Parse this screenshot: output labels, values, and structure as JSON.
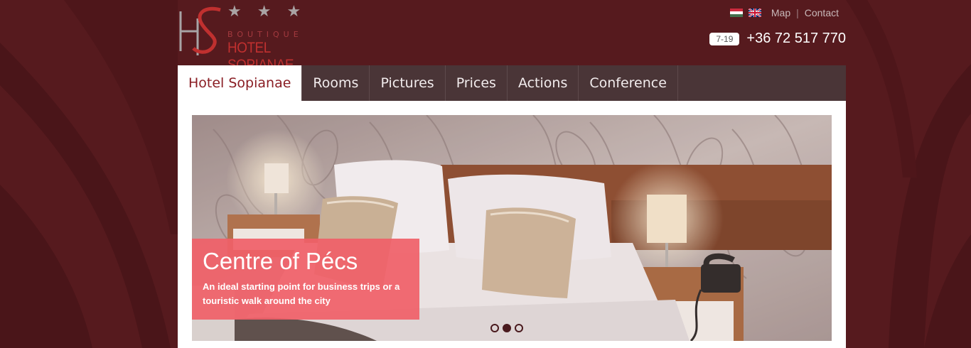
{
  "logo": {
    "stars": [
      "★",
      "★",
      "★"
    ],
    "subtitle": "BOUTIQUE",
    "name": "HOTEL SOPIANAE"
  },
  "header": {
    "flags": [
      "hu-flag-icon",
      "uk-flag-icon"
    ],
    "map_label": "Map",
    "separator": "|",
    "contact_label": "Contact",
    "hours": "7-19",
    "phone": "+36 72 517 770"
  },
  "nav": {
    "items": [
      {
        "label": "Hotel Sopianae",
        "active": true
      },
      {
        "label": "Rooms"
      },
      {
        "label": "Pictures"
      },
      {
        "label": "Prices"
      },
      {
        "label": "Actions"
      },
      {
        "label": "Conference"
      }
    ]
  },
  "slider": {
    "caption_title": "Centre of Pécs",
    "caption_text": "An ideal starting point for business trips or a touristic walk around the city",
    "slide_count": 3,
    "active_slide": 2
  },
  "colors": {
    "background": "#561a1e",
    "nav_bg": "#4a3537",
    "accent": "#8a1e24",
    "caption_bg": "#f06068"
  }
}
